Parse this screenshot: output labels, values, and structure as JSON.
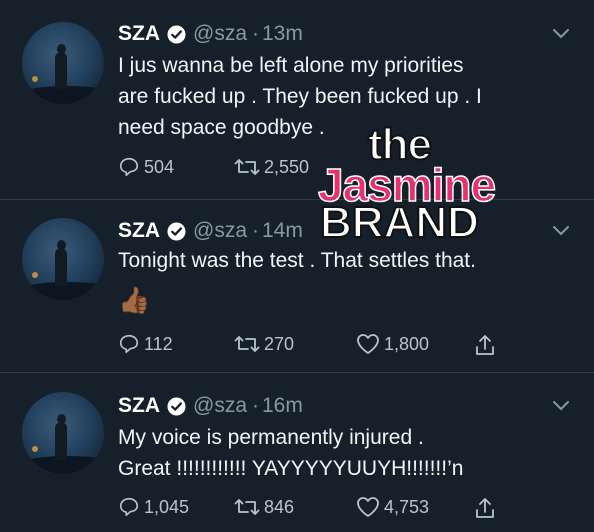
{
  "tweets": [
    {
      "name": "SZA",
      "handle": "@sza",
      "dot": "·",
      "time": "13m",
      "text": "I jus wanna be left alone my priorities\nare fucked up . They been fucked up . I\nneed space goodbye .",
      "replies": "504",
      "retweets": "2,550",
      "likes": ""
    },
    {
      "name": "SZA",
      "handle": "@sza",
      "dot": "·",
      "time": "14m",
      "text": "Tonight was the test . That settles that.",
      "emoji": "👍🏾",
      "replies": "112",
      "retweets": "270",
      "likes": "1,800"
    },
    {
      "name": "SZA",
      "handle": "@sza",
      "dot": "·",
      "time": "16m",
      "text": "My voice is permanently injured .\nGreat !!!!!!!!!!!! YAYYYYYUUYH!!!!!!!’n",
      "replies": "1,045",
      "retweets": "846",
      "likes": "4,753"
    }
  ],
  "watermark": {
    "the": "the",
    "jasmine": "Jasmine",
    "brand": "BRAND"
  },
  "icons": {
    "verified": "verified-badge-icon",
    "chevron": "chevron-down-icon",
    "reply": "reply-icon",
    "retweet": "retweet-icon",
    "like": "heart-icon",
    "share": "share-icon"
  },
  "colors": {
    "background": "#16202b",
    "muted": "#8899a6",
    "jasmine_pink": "#e7316f"
  }
}
